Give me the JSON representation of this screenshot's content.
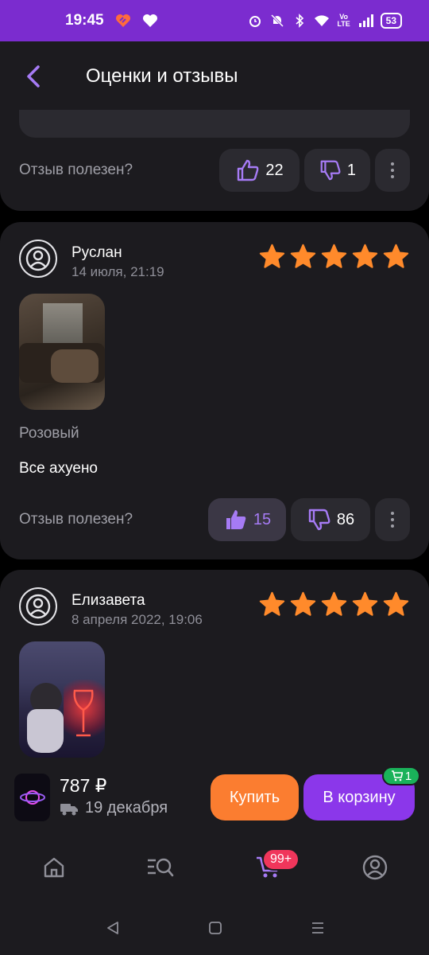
{
  "status_bar": {
    "time": "19:45",
    "battery": "53"
  },
  "app_bar": {
    "title": "Оценки и отзывы"
  },
  "helpful_label": "Отзыв полезен?",
  "reviews": [
    {
      "likes": "22",
      "dislikes": "1"
    },
    {
      "author": "Руслан",
      "date": "14 июля, 21:19",
      "rating": 5,
      "variant": "Розовый",
      "text": "Все ахуено",
      "likes": "15",
      "dislikes": "86"
    },
    {
      "author": "Елизавета",
      "date": "8 апреля 2022, 19:06",
      "rating": 5
    }
  ],
  "buy_bar": {
    "price": "787 ₽",
    "delivery_date": "19 декабря",
    "buy_label": "Купить",
    "cart_label": "В корзину",
    "cart_count": "1"
  },
  "bottom_nav": {
    "cart_badge": "99+"
  },
  "colors": {
    "accent_purple": "#8b37ea",
    "accent_orange": "#fb7d30",
    "star_orange": "#ff8a2b",
    "card_bg": "#1c1b1f",
    "button_bg": "#2b2a30"
  }
}
